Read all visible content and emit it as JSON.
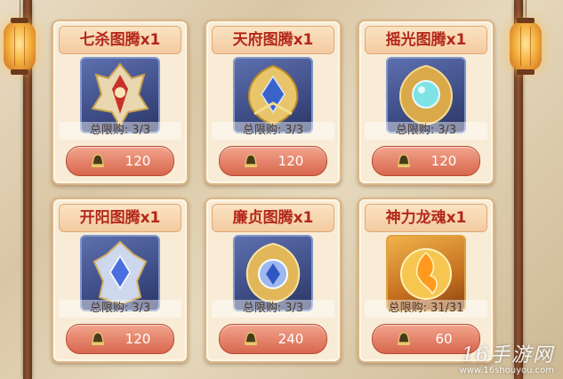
{
  "shop": {
    "items": [
      {
        "title": "七杀图腾x1",
        "limit_label": "总限购:",
        "limit_value": "3/3",
        "price": "120",
        "icon": "totem-qisha-icon"
      },
      {
        "title": "天府图腾x1",
        "limit_label": "总限购:",
        "limit_value": "3/3",
        "price": "120",
        "icon": "totem-tianfu-icon"
      },
      {
        "title": "摇光图腾x1",
        "limit_label": "总限购:",
        "limit_value": "3/3",
        "price": "120",
        "icon": "totem-yaoguang-icon"
      },
      {
        "title": "开阳图腾x1",
        "limit_label": "总限购:",
        "limit_value": "3/3",
        "price": "120",
        "icon": "totem-kaiyang-icon"
      },
      {
        "title": "廉贞图腾x1",
        "limit_label": "总限购:",
        "limit_value": "3/3",
        "price": "240",
        "icon": "totem-lianzhen-icon"
      },
      {
        "title": "神力龙魂x1",
        "limit_label": "总限购:",
        "limit_value": "31/31",
        "price": "60",
        "icon": "dragon-soul-icon"
      }
    ],
    "currency_icon": "bell-coin-icon"
  },
  "watermark": {
    "brand": "16手游网",
    "url": "www.16shouyou.com"
  },
  "colors": {
    "title_text": "#b3281b",
    "button": "#d8664e",
    "card_bg": "#f8ecd6"
  }
}
